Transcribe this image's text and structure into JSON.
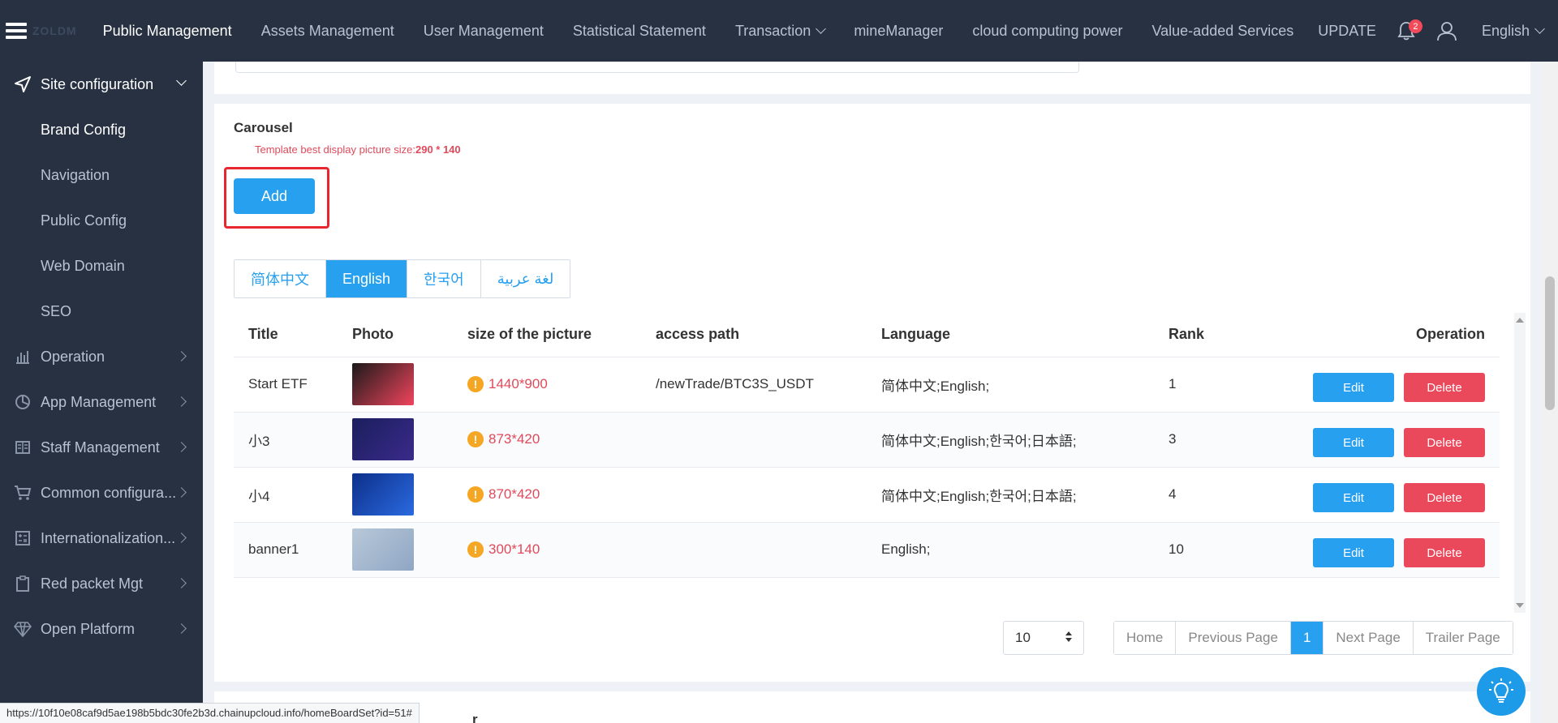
{
  "header": {
    "logo_text": "ZOLDM",
    "nav": [
      {
        "label": "Public Management",
        "active": true,
        "dropdown": false
      },
      {
        "label": "Assets Management",
        "active": false,
        "dropdown": false
      },
      {
        "label": "User Management",
        "active": false,
        "dropdown": false
      },
      {
        "label": "Statistical Statement",
        "active": false,
        "dropdown": false
      },
      {
        "label": "Transaction",
        "active": false,
        "dropdown": true
      },
      {
        "label": "mineManager",
        "active": false,
        "dropdown": false
      },
      {
        "label": "cloud computing power",
        "active": false,
        "dropdown": false
      },
      {
        "label": "Value-added Services",
        "active": false,
        "dropdown": false
      },
      {
        "label": "UPDATE",
        "active": false,
        "dropdown": false
      }
    ],
    "notification_count": "2",
    "language": "English"
  },
  "sidebar": {
    "group": {
      "label": "Site configuration",
      "icon": "send-icon"
    },
    "sub_items": [
      {
        "label": "Brand Config",
        "active": true
      },
      {
        "label": "Navigation",
        "active": false
      },
      {
        "label": "Public Config",
        "active": false
      },
      {
        "label": "Web Domain",
        "active": false
      },
      {
        "label": "SEO",
        "active": false
      }
    ],
    "items": [
      {
        "label": "Operation",
        "icon": "bar-chart-icon"
      },
      {
        "label": "App Management",
        "icon": "pie-chart-icon"
      },
      {
        "label": "Staff Management",
        "icon": "book-icon"
      },
      {
        "label": "Common configura...",
        "icon": "cart-icon"
      },
      {
        "label": "Internationalization...",
        "icon": "calculator-icon"
      },
      {
        "label": "Red packet Mgt",
        "icon": "clipboard-icon"
      },
      {
        "label": "Open Platform",
        "icon": "diamond-icon"
      }
    ]
  },
  "carousel": {
    "title": "Carousel",
    "hint_prefix": "Template best display picture size:",
    "hint_size": "290 * 140",
    "add_label": "Add",
    "tabs": [
      {
        "label": "简体中文",
        "active": false
      },
      {
        "label": "English",
        "active": true
      },
      {
        "label": "한국어",
        "active": false
      },
      {
        "label": "لغة عربية",
        "active": false
      }
    ],
    "columns": [
      "Title",
      "Photo",
      "size of the picture",
      "access path",
      "Language",
      "Rank",
      "Operation"
    ],
    "rows": [
      {
        "title": "Start ETF",
        "photo_colors": [
          "#1a1a1a",
          "#f2445c"
        ],
        "size": "1440*900",
        "path": "/newTrade/BTC3S_USDT",
        "language": "简体中文;English;",
        "rank": "1"
      },
      {
        "title": "小3",
        "photo_colors": [
          "#1b1f5e",
          "#3a2a8a"
        ],
        "size": "873*420",
        "path": "",
        "language": "简体中文;English;한국어;日本語;",
        "rank": "3"
      },
      {
        "title": "小4",
        "photo_colors": [
          "#0d2f8a",
          "#2a6ae0"
        ],
        "size": "870*420",
        "path": "",
        "language": "简体中文;English;한국어;日本語;",
        "rank": "4"
      },
      {
        "title": "banner1",
        "photo_colors": [
          "#b8c8d8",
          "#8fa6c4"
        ],
        "size": "300*140",
        "path": "",
        "language": "English;",
        "rank": "10"
      }
    ],
    "edit_label": "Edit",
    "delete_label": "Delete",
    "page_size": "10",
    "pager": [
      "Home",
      "Previous Page",
      "1",
      "Next Page",
      "Trailer Page"
    ],
    "current_page": "1"
  },
  "bottom_section_fragment": "r",
  "status_url": "https://10f10e08caf9d5ae198b5bdc30fe2b3d.chainupcloud.info/homeBoardSet?id=51#",
  "colors": {
    "primary": "#28a0f0",
    "danger": "#e9495b",
    "sidebar_bg": "#273142",
    "highlight": "#e8262e",
    "warning": "#f5a623"
  }
}
